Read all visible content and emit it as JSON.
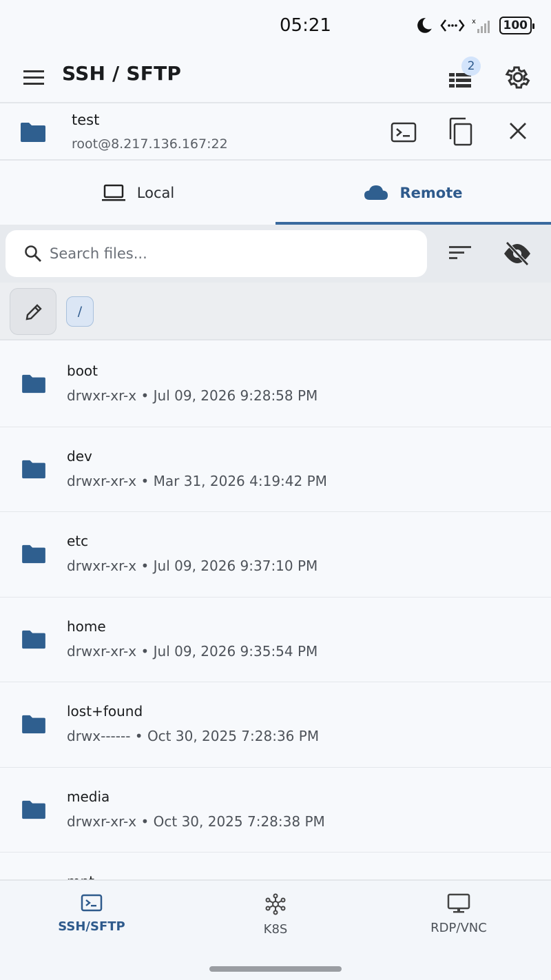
{
  "status": {
    "time": "05:21",
    "battery": "100"
  },
  "app_bar": {
    "title": "SSH / SFTP",
    "queue_badge": "2"
  },
  "connection": {
    "name": "test",
    "host": "root@8.217.136.167:22"
  },
  "tabs": [
    {
      "label": "Local",
      "icon": "laptop-icon",
      "active": false
    },
    {
      "label": "Remote",
      "icon": "cloud-icon",
      "active": true
    }
  ],
  "search": {
    "placeholder": "Search files...",
    "value": ""
  },
  "path": {
    "current": "/"
  },
  "files": [
    {
      "name": "boot",
      "perms": "drwxr-xr-x",
      "date": "Jul 09, 2026 9:28:58 PM"
    },
    {
      "name": "dev",
      "perms": "drwxr-xr-x",
      "date": "Mar 31, 2026 4:19:42 PM"
    },
    {
      "name": "etc",
      "perms": "drwxr-xr-x",
      "date": "Jul 09, 2026 9:37:10 PM"
    },
    {
      "name": "home",
      "perms": "drwxr-xr-x",
      "date": "Jul 09, 2026 9:35:54 PM"
    },
    {
      "name": "lost+found",
      "perms": "drwx------",
      "date": "Oct 30, 2025 7:28:36 PM"
    },
    {
      "name": "media",
      "perms": "drwxr-xr-x",
      "date": "Oct 30, 2025 7:28:38 PM"
    },
    {
      "name": "mnt",
      "perms": "",
      "date": ""
    }
  ],
  "bottom_nav": [
    {
      "label": "SSH/SFTP",
      "icon": "terminal-icon",
      "active": true
    },
    {
      "label": "K8S",
      "icon": "network-icon",
      "active": false
    },
    {
      "label": "RDP/VNC",
      "icon": "monitor-icon",
      "active": false
    }
  ],
  "colors": {
    "accent": "#2e5a8c",
    "folder": "#2f5f8f",
    "background": "#f7f9fc"
  }
}
